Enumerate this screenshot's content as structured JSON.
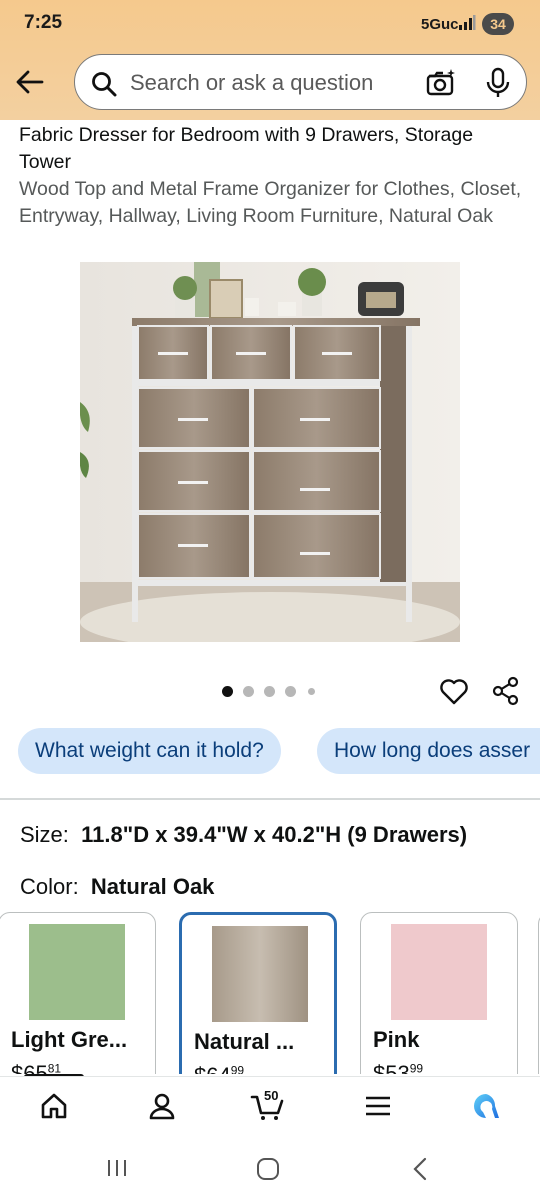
{
  "status": {
    "time": "7:25",
    "network": "5Guc",
    "battery": "34"
  },
  "search": {
    "placeholder": "Search or ask a question"
  },
  "product": {
    "title": "Fabric Dresser for Bedroom with 9 Drawers, Storage Tower",
    "subtitle": "Wood Top and Metal Frame Organizer for Clothes, Closet, Entryway, Hallway, Living Room Furniture, Natural Oak",
    "image_count": 5,
    "current_image": 1
  },
  "chips": [
    {
      "label": "What weight can it hold?"
    },
    {
      "label": "How long does asser"
    }
  ],
  "size": {
    "label": "Size:",
    "value": "11.8\"D x 39.4\"W x 40.2\"H (9 Drawers)"
  },
  "color": {
    "label": "Color:",
    "value": "Natural Oak"
  },
  "swatches": [
    {
      "name": "Light Gre...",
      "price_whole": "$65",
      "price_frac": "81",
      "color": "#9cbe8c",
      "selected": false
    },
    {
      "name": "Natural ...",
      "price_whole": "$64",
      "price_frac": "99",
      "color": "#b9ad9d",
      "selected": true
    },
    {
      "name": "Pink",
      "price_whole": "$53",
      "price_frac": "99",
      "color": "#efc9cc",
      "selected": false
    }
  ],
  "nav": {
    "cart_count": "50"
  },
  "colors": {
    "header": "#f5c98d",
    "chip_bg": "#d4e6fa",
    "chip_text": "#0b3e7a",
    "selected_border": "#2b6cb0",
    "brand_alexa": "#1f8ee8"
  }
}
